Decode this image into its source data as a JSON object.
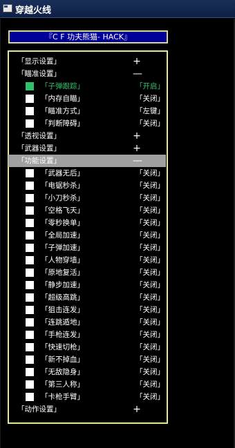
{
  "window": {
    "title": "穿越火线",
    "title_icon": "window-icon"
  },
  "header": "『C F 功夫熊猫- HACK』",
  "colors": {
    "title_bar": "#0e1f44",
    "header_bg": "#000099",
    "border": "#e8e890",
    "active": "#2ec26a",
    "selected_bg": "#a0a0a0"
  },
  "menu": {
    "display_settings": {
      "label": "「显示设置」",
      "sign": "+"
    },
    "aim_settings": {
      "label": "「瞄准设置」",
      "sign": "—"
    },
    "aim_items": [
      {
        "label": "「子弹跟踪」",
        "value": "「开启」",
        "active": true
      },
      {
        "label": "「内存自瞄」",
        "value": "「关闭」"
      },
      {
        "label": "「瞄准方式」",
        "value": "「左键」"
      },
      {
        "label": "「判断障碍」",
        "value": "「关闭」"
      }
    ],
    "see_through_settings": {
      "label": "「透视设置」",
      "sign": "+"
    },
    "weapon_settings": {
      "label": "「武器设置」",
      "sign": "+"
    },
    "function_settings": {
      "label": "「功能设置」",
      "sign": "—"
    },
    "function_items": [
      {
        "label": "「武器无后」",
        "value": "「关闭」"
      },
      {
        "label": "「电锯秒杀」",
        "value": "「关闭」"
      },
      {
        "label": "「小刀秒杀」",
        "value": "「关闭」"
      },
      {
        "label": "「空格飞天」",
        "value": "「关闭」"
      },
      {
        "label": "「零秒换单」",
        "value": "「关闭」"
      },
      {
        "label": "「全局加速」",
        "value": "「关闭」"
      },
      {
        "label": "「子弹加速」",
        "value": "「关闭」"
      },
      {
        "label": "「人物穿墙」",
        "value": "「关闭」"
      },
      {
        "label": "「原地复活」",
        "value": "「关闭」"
      },
      {
        "label": "「静步加速」",
        "value": "「关闭」"
      },
      {
        "label": "「超级高跳」",
        "value": "「关闭」"
      },
      {
        "label": "「狙击连发」",
        "value": "「关闭」"
      },
      {
        "label": "「连跳遁地」",
        "value": "「关闭」"
      },
      {
        "label": "「手枪连发」",
        "value": "「关闭」"
      },
      {
        "label": "「快速切枪」",
        "value": "「关闭」"
      },
      {
        "label": "「新不掉血」",
        "value": "「关闭」"
      },
      {
        "label": "「无敌隐身」",
        "value": "「关闭」"
      },
      {
        "label": "「第三人称」",
        "value": "「关闭」"
      },
      {
        "label": "「卡枪手臂」",
        "value": "「关闭」"
      }
    ],
    "action_settings": {
      "label": "「动作设置」",
      "sign": "+"
    }
  }
}
